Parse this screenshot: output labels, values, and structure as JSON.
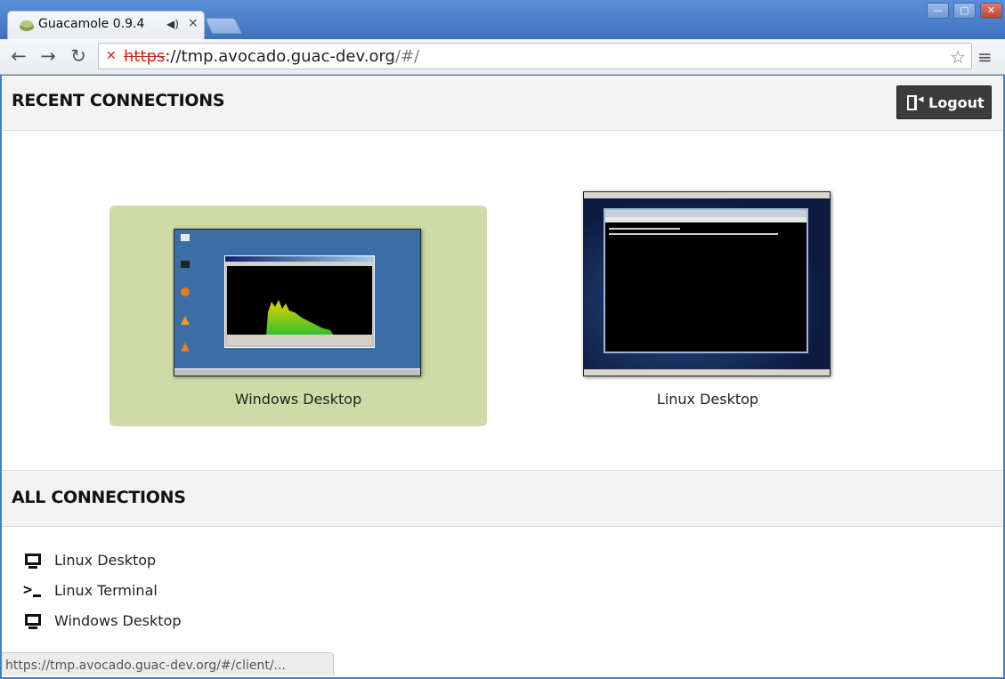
{
  "browser": {
    "tab_title": "Guacamole 0.9.4",
    "tab_audio_icon": "speaker-icon",
    "tab_close": "×",
    "url_scheme": "https",
    "url_host": "://tmp.avocado.guac-dev.org",
    "url_path": "/#/",
    "status_url": "https://tmp.avocado.guac-dev.org/#/client/..."
  },
  "recent": {
    "heading": "RECENT CONNECTIONS",
    "logout_label": "Logout",
    "tiles": [
      {
        "label": "Windows Desktop",
        "selected": true
      },
      {
        "label": "Linux Desktop",
        "selected": false
      }
    ]
  },
  "all": {
    "heading": "ALL CONNECTIONS",
    "items": [
      {
        "label": "Linux Desktop",
        "icon": "monitor-icon"
      },
      {
        "label": "Linux Terminal",
        "icon": "terminal-icon"
      },
      {
        "label": "Windows Desktop",
        "icon": "monitor-icon"
      }
    ]
  },
  "colors": {
    "selected_tile": "#cedba7",
    "logout_bg": "#3c3c3c",
    "insecure_scheme": "#c92a1b"
  }
}
